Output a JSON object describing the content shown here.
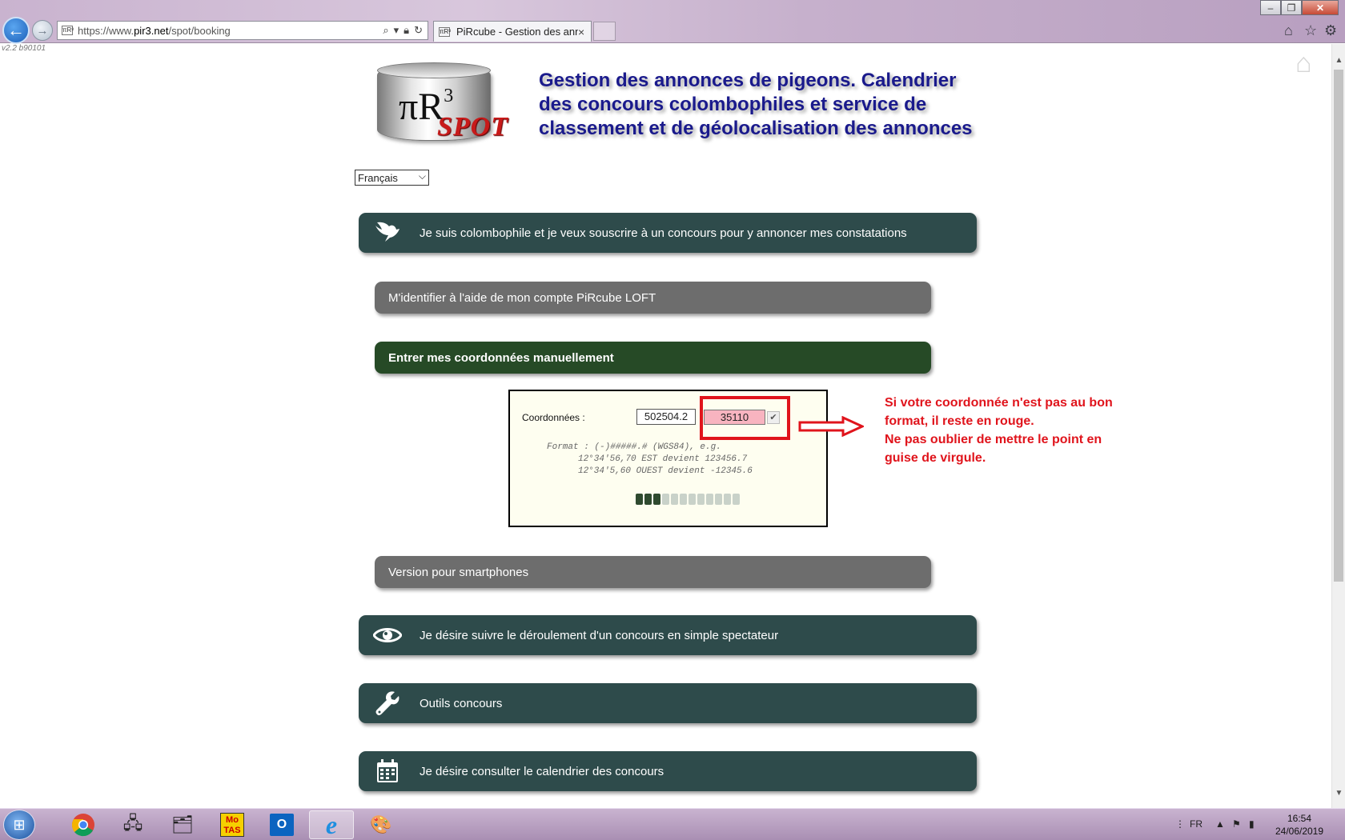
{
  "browser": {
    "url_prefix": "https://www.",
    "url_domain": "pir3.net",
    "url_path": "/spot/booking",
    "tab_title": "PiRcube - Gestion des anno...",
    "favicon_text": "πR³"
  },
  "page": {
    "version": "v2.2 b90101",
    "logo_pi": "πR",
    "logo_exp": "3",
    "logo_spot": "SPOT",
    "title": "Gestion des annonces de pigeons. Calendrier des concours colombophiles et service de classement et de géolocalisation des annonces",
    "language": "Français"
  },
  "menu": {
    "colombophile": "Je suis colombophile et je veux souscrire à un concours pour y annoncer mes constatations",
    "loft_login": "M'identifier à l'aide de mon compte PiRcube LOFT",
    "manual_coords": "Entrer mes coordonnées manuellement",
    "smartphone": "Version pour smartphones",
    "spectator": "Je désire suivre le déroulement d'un concours en simple spectateur",
    "tools": "Outils concours",
    "calendar": "Je désire consulter le calendrier des concours"
  },
  "coords": {
    "label": "Coordonnées :",
    "x_value": "502504.2",
    "y_value": "35110",
    "check": "✔",
    "format_line1": "Format : (-)#####.# (WGS84), e.g.",
    "format_line2": "12°34'56,70 EST devient 123456.7",
    "format_line3": "12°34'5,60 OUEST devient -12345.6",
    "progress": {
      "filled": 3,
      "total": 12
    }
  },
  "annotation": {
    "line1": "Si votre coordonnée n'est pas au bon",
    "line2": "format, il reste en rouge.",
    "line3": "Ne pas oublier de mettre le point en",
    "line4": "guise de virgule."
  },
  "taskbar": {
    "language": "FR",
    "time": "16:54",
    "date": "24/06/2019",
    "motas_label": "Mo\nTAS"
  },
  "colors": {
    "bar_dark": "#2e4b4b",
    "bar_gray": "#6d6d6d",
    "bar_green": "#264a26",
    "annotation_red": "#e0141c",
    "title_blue": "#1a1a8c"
  }
}
